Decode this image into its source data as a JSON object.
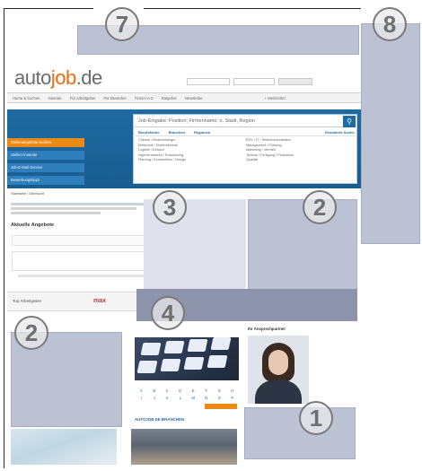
{
  "site": {
    "logo_main": "auto",
    "logo_accent": "job",
    "logo_suffix": ".de",
    "nav": [
      "Home & Suchen",
      "Inserate",
      "Für Arbeitgeber",
      "Für Bewerber",
      "Firmen A-Z",
      "Ratgeber",
      "Newsletter",
      "+ Merkzettel"
    ],
    "side_menu": [
      "Stellenangebote suchen",
      "Stellen-Inserate",
      "Job-E-Mail-Service",
      "Bewerbungstipps"
    ],
    "search_placeholder": "Job-Eingabe: Position, Firmenname, o. Stadt, Region",
    "search_tabs": [
      "Berufsfelder",
      "Branchen",
      "Regionen",
      "Erweiterte Suche"
    ],
    "col1": [
      "Chemie / Biotechnologie",
      "Elektronik / Elektrotechnik",
      "Logistik / Einkauf",
      "Ingenieurwesen / Entwicklung",
      "Planung / Konstruktion / Design"
    ],
    "col2": [
      "EDV / IT / Telekommunikation",
      "Management / Führung",
      "Marketing / Vertrieb",
      "Technik / Fertigung / Produktion",
      "Qualität"
    ],
    "breadcrumb": "Startseite / Übersicht",
    "results_label": "Aktuelle Angebote",
    "partner": "Top Arbeitgeber",
    "jobs_label": "AUTOJOB.DE BRANCHEN",
    "contact_label": "Ihr Ansprechpartner"
  },
  "callouts": [
    "1",
    "2",
    "2",
    "3",
    "4",
    "7",
    "8"
  ],
  "colors": {
    "overlay": "#bcc2d3",
    "overlay_dark": "#8c93ab",
    "banner": "#1e6aa2",
    "accent": "#ec8a16"
  }
}
